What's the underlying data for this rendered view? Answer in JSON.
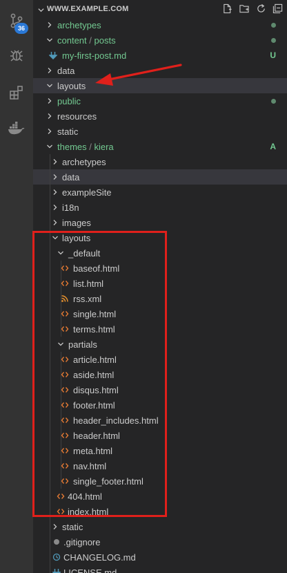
{
  "colors": {
    "folder_text": "#cccccc",
    "git_modified": "#73c991",
    "html_icon": "#e37933",
    "rss_icon": "#e8912d",
    "markdown_icon": "#519aba",
    "annotation": "#e0201b",
    "badge": "#2a78d6"
  },
  "activity_bar": {
    "items": [
      {
        "icon": "source-control-icon",
        "badge": "36"
      },
      {
        "icon": "debug-icon"
      },
      {
        "icon": "extensions-icon"
      },
      {
        "icon": "docker-icon"
      }
    ]
  },
  "explorer": {
    "title": "WWW.EXAMPLE.COM",
    "actions": [
      "new-file-icon",
      "new-folder-icon",
      "refresh-icon",
      "collapse-all-icon"
    ],
    "tree": [
      {
        "label": "archetypes",
        "type": "folder",
        "expanded": false,
        "depth": 0,
        "color": "git",
        "status": "dot"
      },
      {
        "label": "content",
        "sep": "/",
        "label2": "posts",
        "type": "folder",
        "expanded": true,
        "depth": 0,
        "color": "git",
        "status": "dot"
      },
      {
        "label": "my-first-post.md",
        "type": "file",
        "icon": "markdown",
        "depth": 0.5,
        "color": "git",
        "status": "U"
      },
      {
        "label": "data",
        "type": "folder",
        "expanded": false,
        "depth": 0,
        "color": "plain"
      },
      {
        "label": "layouts",
        "type": "folder",
        "expanded": true,
        "depth": 0,
        "color": "plain",
        "highlight": true
      },
      {
        "label": "public",
        "type": "folder",
        "expanded": false,
        "depth": 0,
        "color": "git",
        "status": "dot"
      },
      {
        "label": "resources",
        "type": "folder",
        "expanded": false,
        "depth": 0,
        "color": "plain"
      },
      {
        "label": "static",
        "type": "folder",
        "expanded": false,
        "depth": 0,
        "color": "plain"
      },
      {
        "label": "themes",
        "sep": "/",
        "label2": "kiera",
        "type": "folder",
        "expanded": true,
        "depth": 0,
        "color": "git",
        "status": "A"
      },
      {
        "label": "archetypes",
        "type": "folder",
        "expanded": false,
        "depth": 1,
        "color": "plain"
      },
      {
        "label": "data",
        "type": "folder",
        "expanded": false,
        "depth": 1,
        "color": "plain",
        "highlight": true
      },
      {
        "label": "exampleSite",
        "type": "folder",
        "expanded": false,
        "depth": 1,
        "color": "plain"
      },
      {
        "label": "i18n",
        "type": "folder",
        "expanded": false,
        "depth": 1,
        "color": "plain"
      },
      {
        "label": "images",
        "type": "folder",
        "expanded": false,
        "depth": 1,
        "color": "plain"
      },
      {
        "label": "layouts",
        "type": "folder",
        "expanded": true,
        "depth": 1,
        "color": "plain"
      },
      {
        "label": "_default",
        "type": "folder",
        "expanded": true,
        "depth": 2,
        "color": "plain"
      },
      {
        "label": "baseof.html",
        "type": "file",
        "icon": "html",
        "depth": 3,
        "color": "plain"
      },
      {
        "label": "list.html",
        "type": "file",
        "icon": "html",
        "depth": 3,
        "color": "plain"
      },
      {
        "label": "rss.xml",
        "type": "file",
        "icon": "rss",
        "depth": 3,
        "color": "plain"
      },
      {
        "label": "single.html",
        "type": "file",
        "icon": "html",
        "depth": 3,
        "color": "plain"
      },
      {
        "label": "terms.html",
        "type": "file",
        "icon": "html",
        "depth": 3,
        "color": "plain"
      },
      {
        "label": "partials",
        "type": "folder",
        "expanded": true,
        "depth": 2,
        "color": "plain"
      },
      {
        "label": "article.html",
        "type": "file",
        "icon": "html",
        "depth": 3,
        "color": "plain"
      },
      {
        "label": "aside.html",
        "type": "file",
        "icon": "html",
        "depth": 3,
        "color": "plain"
      },
      {
        "label": "disqus.html",
        "type": "file",
        "icon": "html",
        "depth": 3,
        "color": "plain"
      },
      {
        "label": "footer.html",
        "type": "file",
        "icon": "html",
        "depth": 3,
        "color": "plain"
      },
      {
        "label": "header_includes.html",
        "type": "file",
        "icon": "html",
        "depth": 3,
        "color": "plain"
      },
      {
        "label": "header.html",
        "type": "file",
        "icon": "html",
        "depth": 3,
        "color": "plain"
      },
      {
        "label": "meta.html",
        "type": "file",
        "icon": "html",
        "depth": 3,
        "color": "plain"
      },
      {
        "label": "nav.html",
        "type": "file",
        "icon": "html",
        "depth": 3,
        "color": "plain"
      },
      {
        "label": "single_footer.html",
        "type": "file",
        "icon": "html",
        "depth": 3,
        "color": "plain"
      },
      {
        "label": "404.html",
        "type": "file",
        "icon": "html",
        "depth": 2,
        "color": "plain"
      },
      {
        "label": "index.html",
        "type": "file",
        "icon": "html",
        "depth": 2,
        "color": "plain"
      },
      {
        "label": "static",
        "type": "folder",
        "expanded": false,
        "depth": 1,
        "color": "plain"
      },
      {
        "label": ".gitignore",
        "type": "file",
        "icon": "gitignore",
        "depth": 1,
        "color": "plain"
      },
      {
        "label": "CHANGELOG.md",
        "type": "file",
        "icon": "changelog",
        "depth": 1,
        "color": "plain"
      },
      {
        "label": "LICENSE.md",
        "type": "file",
        "icon": "markdown",
        "depth": 1,
        "color": "plain"
      }
    ]
  }
}
